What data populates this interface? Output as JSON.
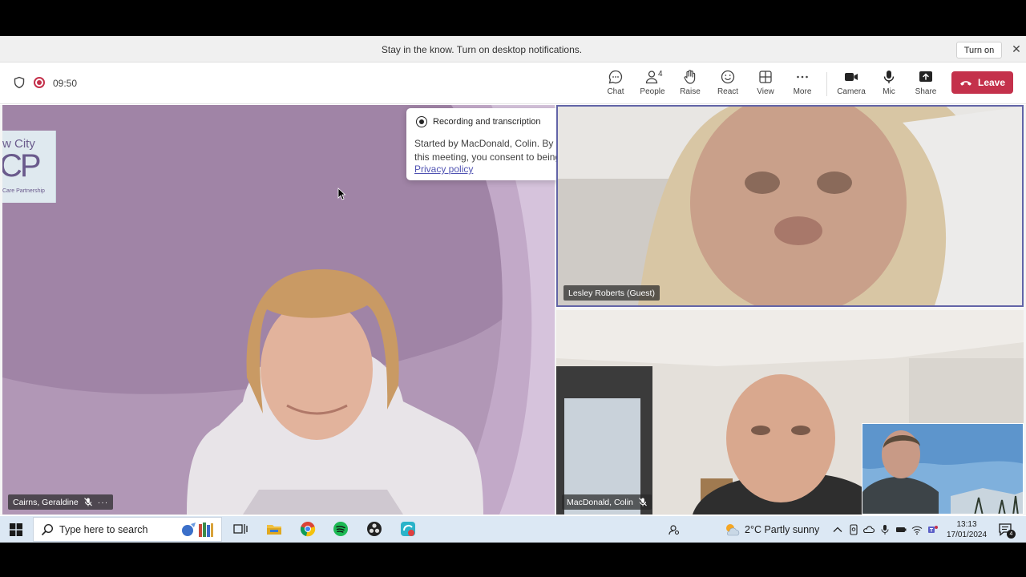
{
  "banner": {
    "message": "Stay in the know. Turn on desktop notifications.",
    "turn_on_label": "Turn on"
  },
  "meeting": {
    "timer": "09:50"
  },
  "toolbar": {
    "chat": "Chat",
    "people": "People",
    "people_count": "4",
    "raise": "Raise",
    "react": "React",
    "view": "View",
    "more": "More",
    "camera": "Camera",
    "mic": "Mic",
    "share": "Share",
    "leave": "Leave",
    "leave_color": "#c4314b"
  },
  "recording_toast": {
    "title": "Recording and transcription",
    "body": "Started by MacDonald, Colin. By attending this meeting, you consent to being included.",
    "link": "Privacy policy"
  },
  "participants": [
    {
      "name": "Cairns, Geraldine",
      "muted": true,
      "has_more_menu": true
    },
    {
      "name": "Lesley Roberts (Guest)",
      "muted": false,
      "active_speaker": true
    },
    {
      "name": "MacDonald, Colin",
      "muted": true
    }
  ],
  "background_logo": {
    "line1": "w City",
    "line2": "CP",
    "line3": "Care Partnership"
  },
  "taskbar": {
    "search_placeholder": "Type here to search",
    "weather": "2°C  Partly sunny",
    "time": "13:13",
    "date": "17/01/2024",
    "notification_count": "4"
  }
}
